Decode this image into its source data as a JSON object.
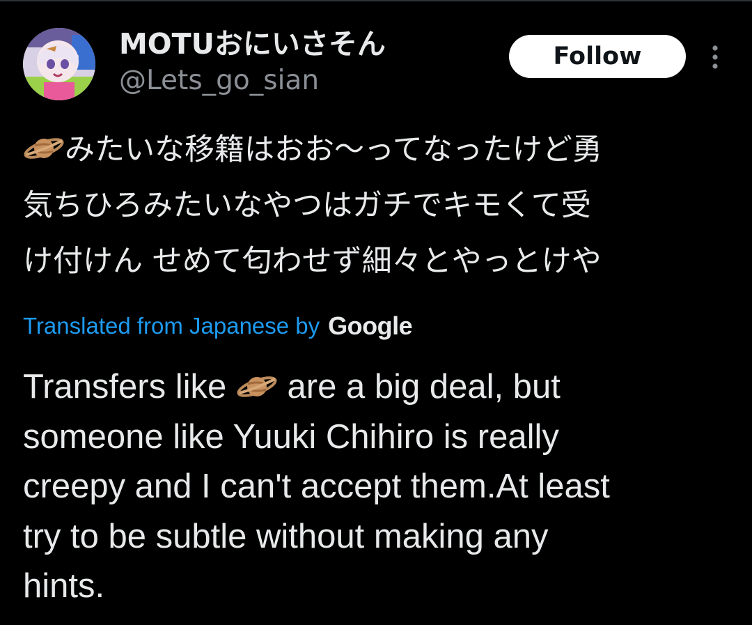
{
  "user": {
    "display_name": "MOTUおにいさそん",
    "handle": "@Lets_go_sian",
    "avatar_icon": "anime-avatar-icon"
  },
  "header": {
    "follow_label": "Follow",
    "more_icon": "more-vertical-icon"
  },
  "tweet": {
    "original_icon": "ringed-planet-emoji",
    "original_lines": [
      "みたいな移籍はおお〜ってなったけど勇",
      "気ちひろみたいなやつはガチでキモくて受",
      "け付けん せめて匂わせず細々とやっとけや"
    ],
    "translation_label": "Translated from Japanese by",
    "translation_provider": "Google",
    "translated_line1_before": "Transfers like",
    "translated_line1_after": "are a big deal, but",
    "translated_lines": [
      "someone like Yuuki Chihiro is really",
      "creepy and I can't accept them.At least",
      "try to be subtle without making any",
      "hints."
    ]
  },
  "colors": {
    "background": "#000000",
    "text": "#e7e9ea",
    "secondary": "#8b9096",
    "link": "#1d9bf0",
    "follow_bg": "#ffffff"
  }
}
